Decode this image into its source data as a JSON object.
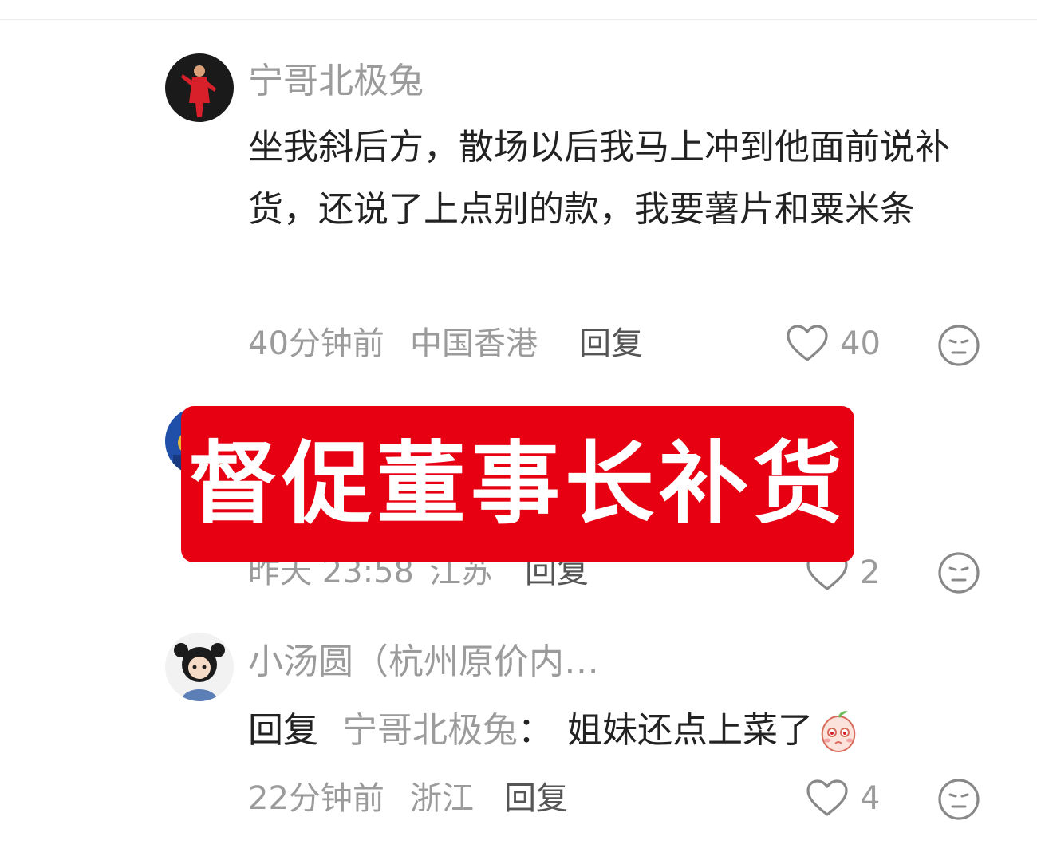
{
  "comments": [
    {
      "username": "宁哥北极兔",
      "text": "坐我斜后方，散场以后我马上冲到他面前说补货，还说了上点别的款，我要薯片和粟米条",
      "time": "40分钟前",
      "location": "中国香港",
      "reply_label": "回复",
      "likes": "40"
    },
    {
      "time": "昨天 23:58",
      "location": "江苏",
      "reply_label": "回复",
      "likes": "2"
    },
    {
      "username": "小汤圆（杭州原价内…",
      "reply_prefix": "回复",
      "reply_to": "宁哥北极兔",
      "reply_sep": "：",
      "text": "姐妹还点上菜了",
      "time": "22分钟前",
      "location": "浙江",
      "reply_label": "回复",
      "likes": "4"
    }
  ],
  "banner": {
    "text": "督促董事长补货",
    "color": "#e60012"
  },
  "icons": {
    "like": "heart-outline-icon",
    "dislike": "neutral-face-icon",
    "emoji": "peach-shy-emoji-icon"
  }
}
